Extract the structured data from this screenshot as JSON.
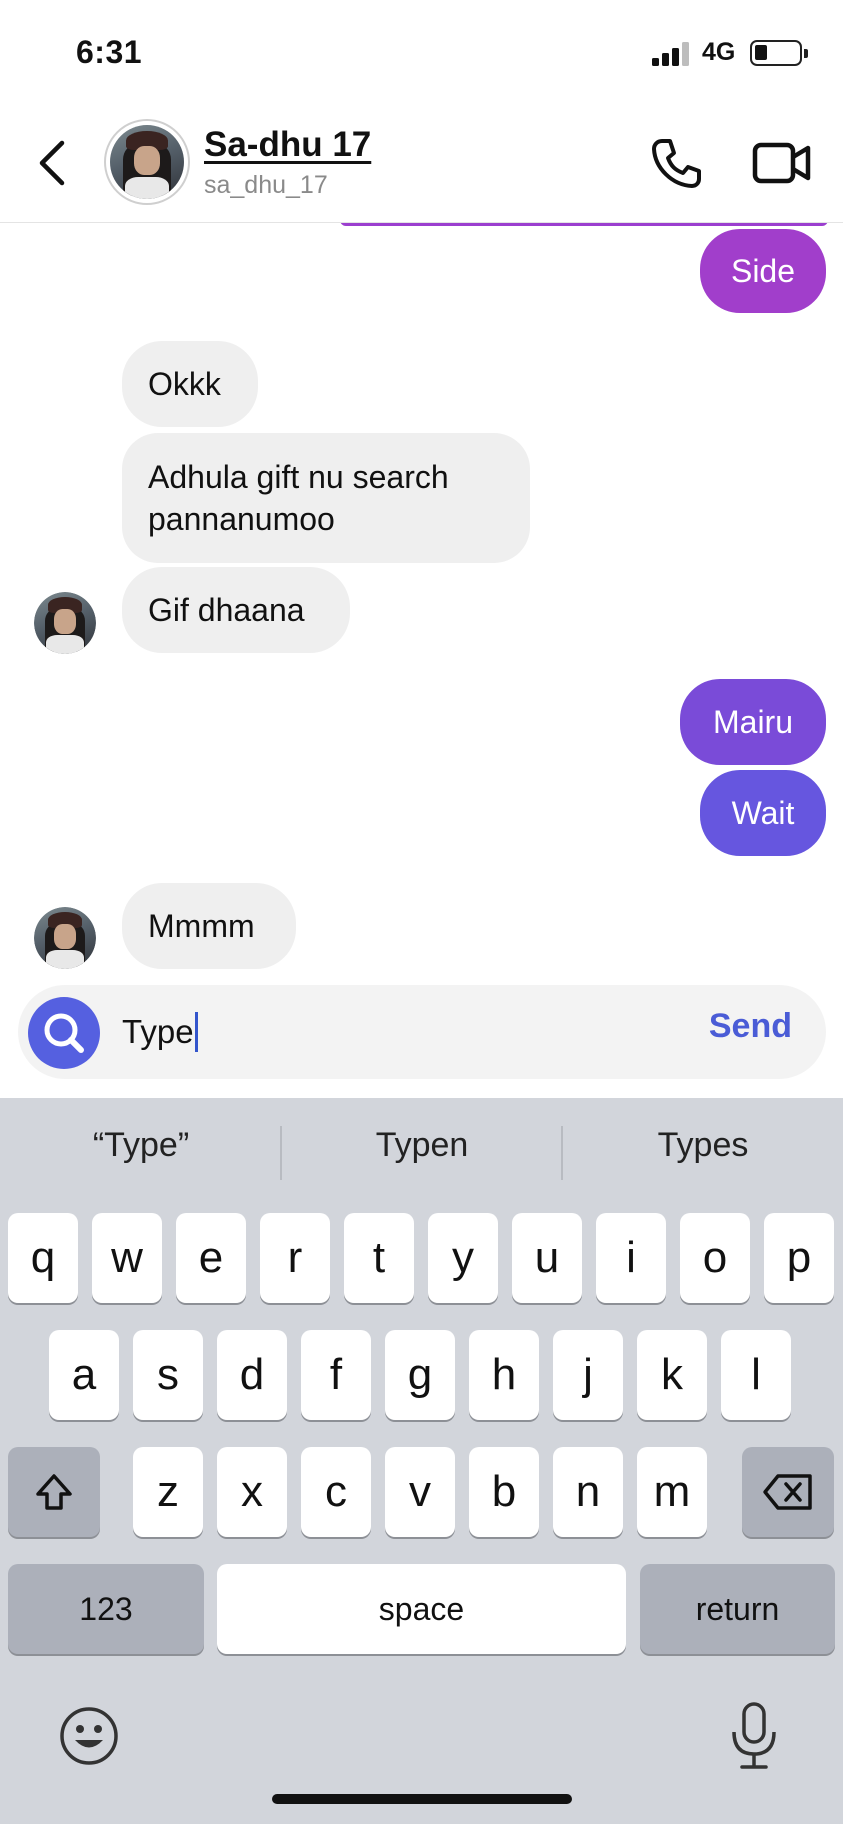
{
  "status_bar": {
    "time": "6:31",
    "network": "4G"
  },
  "header": {
    "name": "Sa-dhu 17",
    "handle": "sa_dhu_17"
  },
  "messages": [
    {
      "id": "m1",
      "direction": "out",
      "text": "Side",
      "color": "#a13ecb"
    },
    {
      "id": "m2",
      "direction": "in",
      "text": "Okkk"
    },
    {
      "id": "m3",
      "direction": "in",
      "text": "Adhula gift nu search pannanumoo"
    },
    {
      "id": "m4",
      "direction": "in",
      "text": "Gif dhaana"
    },
    {
      "id": "m5",
      "direction": "out",
      "text": "Mairu",
      "color": "#7a4bd8"
    },
    {
      "id": "m6",
      "direction": "out",
      "text": "Wait",
      "color": "#6656df"
    },
    {
      "id": "m7",
      "direction": "in",
      "text": "Mmmm"
    }
  ],
  "composer": {
    "value": "Type",
    "send_label": "Send"
  },
  "keyboard": {
    "suggestions": [
      "“Type”",
      "Typen",
      "Types"
    ],
    "row1": [
      "q",
      "w",
      "e",
      "r",
      "t",
      "y",
      "u",
      "i",
      "o",
      "p"
    ],
    "row2": [
      "a",
      "s",
      "d",
      "f",
      "g",
      "h",
      "j",
      "k",
      "l"
    ],
    "row3": [
      "z",
      "x",
      "c",
      "v",
      "b",
      "n",
      "m"
    ],
    "numbers_label": "123",
    "space_label": "space",
    "return_label": "return"
  },
  "icons": {
    "back": "chevron-left-icon",
    "call": "phone-icon",
    "video": "video-camera-icon",
    "search": "search-icon",
    "shift": "shift-icon",
    "delete": "backspace-icon",
    "emoji": "emoji-icon",
    "mic": "microphone-icon"
  },
  "colors": {
    "accent": "#5560e0",
    "send": "#4a5cd6"
  }
}
